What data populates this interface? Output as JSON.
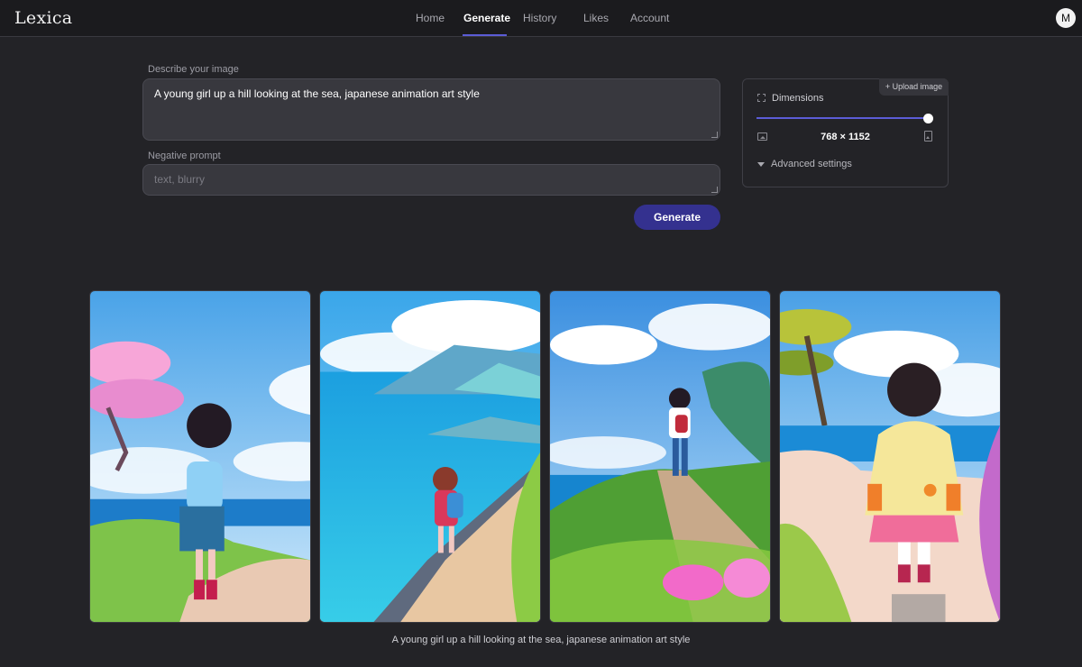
{
  "app": {
    "logo_text": "Lexica"
  },
  "nav": {
    "items": [
      {
        "label": "Home",
        "active": false
      },
      {
        "label": "Generate",
        "active": true
      },
      {
        "label": "History",
        "active": false
      },
      {
        "label": "Likes",
        "active": false
      },
      {
        "label": "Account",
        "active": false
      }
    ],
    "avatar_initial": "M"
  },
  "form": {
    "prompt_label": "Describe your image",
    "prompt_value": "A young girl up a hill looking at the sea, japanese animation art style",
    "negative_label": "Negative prompt",
    "negative_placeholder": "text, blurry",
    "negative_value": "",
    "generate_label": "Generate"
  },
  "settings": {
    "upload_label": "+ Upload image",
    "dimensions_label": "Dimensions",
    "dimensions_value": "768 × 1152",
    "slider_fraction": 1.0,
    "advanced_label": "Advanced settings"
  },
  "results": {
    "caption": "A young girl up a hill looking at the sea, japanese animation art style",
    "image_count": 4
  },
  "colors": {
    "accent": "#5b5cd6",
    "button": "#34318f",
    "background": "#232327",
    "topbar": "#1b1b1e"
  }
}
